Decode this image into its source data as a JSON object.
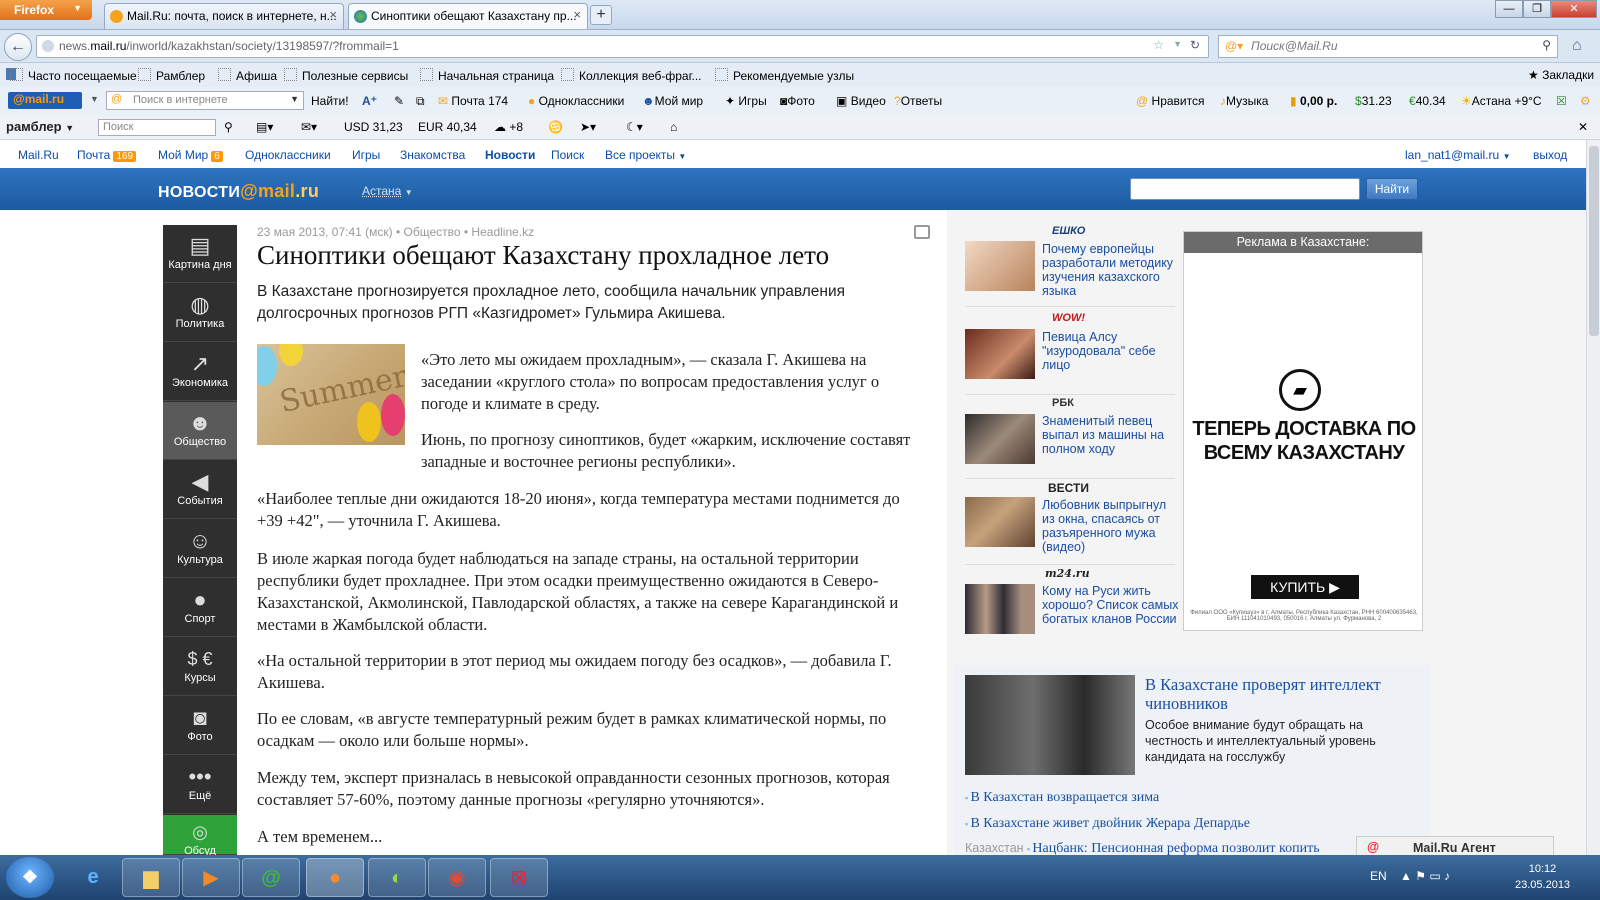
{
  "browser": {
    "menu_button": "Firefox",
    "tabs": [
      {
        "title": "Mail.Ru: почта, поиск в интернете, н..."
      },
      {
        "title": "Синоптики обещают Казахстану пр..."
      }
    ],
    "url_host": "news.mail.ru",
    "url_path": "/inworld/kazakhstan/society/13198597/?frommail=1",
    "url_prefix": "news.",
    "search_placeholder": "Поиск@Mail.Ru"
  },
  "bookmarks": {
    "items": [
      "Часто посещаемые",
      "Рамблер",
      "Афиша",
      "Полезные сервисы",
      "Начальная страница",
      "Коллекция веб-фраг...",
      "Рекомендуемые узлы"
    ],
    "right": "Закладки"
  },
  "mail_toolbar": {
    "logo_text": "@mail.ru",
    "search_placeholder": "Поиск в интернете",
    "find": "Найти!",
    "mail": "Почта 174",
    "ok": "Одноклассники",
    "myworld": "Мой мир",
    "games": "Игры",
    "photo": "Фото",
    "video": "Видео",
    "answers": "Ответы",
    "like": "Нравится",
    "music": "Музыка",
    "money": "0,00 р.",
    "usd": "31.23",
    "eur": "40.34",
    "weather": "Астана +9°C"
  },
  "rambler_toolbar": {
    "logo": "рамблер",
    "search_placeholder": "Поиск",
    "usd": "USD 31,23",
    "eur": "EUR 40,34",
    "weather": "+8"
  },
  "portal_nav": {
    "items": [
      "Mail.Ru",
      "Почта",
      "Мой Мир",
      "Одноклассники",
      "Игры",
      "Знакомства",
      "Новости",
      "Поиск",
      "Все проекты"
    ],
    "mail_count": "169",
    "world_count": "6",
    "user": "lan_nat1@mail.ru",
    "logout": "выход"
  },
  "news_header": {
    "logo_pre": "новости",
    "logo_at": "@mail",
    "logo_ru": ".ru",
    "city": "Астана",
    "search_button": "Найти"
  },
  "rubrics": [
    "Картина дня",
    "Политика",
    "Экономика",
    "Общество",
    "События",
    "Культура",
    "Спорт",
    "Курсы",
    "Фото",
    "Ещё",
    "Обсуд"
  ],
  "article": {
    "meta": "23 мая 2013, 07:41 (мск) • Общество • Headline.kz",
    "title": "Синоптики обещают Казахстану прохладное лето",
    "lead": "В Казахстане прогнозируется прохладное лето, сообщила начальник управления долгосрочных прогнозов РГП «Казгидромет» Гульмира Акишева.",
    "image_word": "Summer",
    "paragraphs": [
      "«Это лето мы ожидаем прохладным», — сказала Г. Акишева на заседании «круглого стола» по вопросам предоставления услуг о погоде и климате в среду.",
      "Июнь, по прогнозу синоптиков, будет «жарким, исключение составят западные и восточнее регионы республики».",
      "«Наиболее теплые дни ожидаются 18-20 июня», когда температура местами поднимется до +39 +42\", — уточнила Г. Акишева.",
      "В июле жаркая погода будет наблюдаться на западе страны, на остальной территории республики будет прохладнее. При этом осадки преимущественно ожидаются в Северо-Казахстанской, Акмолинской, Павлодарской областях, а также на севере Карагандинской и местами в Жамбылской области.",
      "«На остальной территории в этот период мы ожидаем погоду без осадков», — добавила Г. Акишева.",
      "По ее словам, «в августе температурный режим будет в рамках климатической нормы, по осадкам — около или больше нормы».",
      "Между тем, эксперт призналась в невысокой оправданности сезонных прогнозов, которая составляет 57-60%, поэтому данные прогнозы «регулярно уточняются».",
      "А тем временем..."
    ]
  },
  "side_news": [
    {
      "source": "ЕШКО",
      "text": "Почему европейцы разработали методику изучения казахского языка"
    },
    {
      "source": "WOW!",
      "text": "Певица Алсу \"изуродовала\" себе лицо"
    },
    {
      "source": "РБК",
      "text": "Знаменитый певец выпал из машины на полном ходу"
    },
    {
      "source": "ВЕСТИ",
      "text": "Любовник выпрыгнул из окна, спасаясь от разъяренного мужа (видео)"
    },
    {
      "source": "m24.ru",
      "text": "Кому на Руси жить хорошо? Список самых богатых кланов России"
    }
  ],
  "ad": {
    "header": "Реклама в Казахстане:",
    "title": "ТЕПЕРЬ ДОСТАВКА ПО ВСЕМУ КАЗАХСТАНУ",
    "button": "КУПИТЬ ▶",
    "fine": "Филиал ООО «Купишуз» в г. Алматы, Республика Казахстан, РНН 600400635463, БИН 111041010493, 050016 г. Алматы ул. Фурманова, 2"
  },
  "featured": {
    "title": "В Казахстане проверят интеллект чиновников",
    "text": "Особое внимание будут обращать на честность и интеллектуальный уровень кандидата на госслужбу",
    "links": [
      "В Казахстан возвращается зима",
      "В Казахстане живет двойник Жерара Депардье"
    ],
    "last_tag": "Казахстан",
    "last_link": "Нацбанк: Пенсионная реформа позволит копить"
  },
  "agent": {
    "label": "Mail.Ru Агент"
  },
  "taskbar": {
    "lang": "EN",
    "time": "10:12",
    "date": "23.05.2013"
  }
}
